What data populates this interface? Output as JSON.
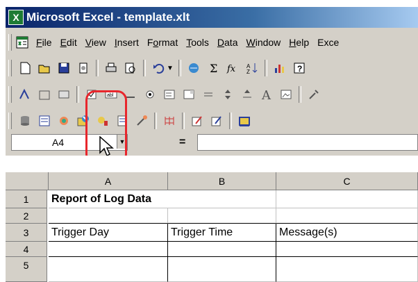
{
  "window": {
    "title": "Microsoft Excel - template.xlt",
    "app_icon_letter": "X"
  },
  "menu": {
    "items": [
      {
        "label": "File",
        "key": "F"
      },
      {
        "label": "Edit",
        "key": "E"
      },
      {
        "label": "View",
        "key": "V"
      },
      {
        "label": "Insert",
        "key": "I"
      },
      {
        "label": "Format",
        "key": "o"
      },
      {
        "label": "Tools",
        "key": "T"
      },
      {
        "label": "Data",
        "key": "D"
      },
      {
        "label": "Window",
        "key": "W"
      },
      {
        "label": "Help",
        "key": "H"
      },
      {
        "label": "Exce",
        "key": ""
      }
    ]
  },
  "formula": {
    "name_box": "A4",
    "equals": "="
  },
  "sheet": {
    "columns": [
      "A",
      "B",
      "C"
    ],
    "rows": [
      "1",
      "2",
      "3",
      "4",
      "5"
    ],
    "cells": {
      "A1": "Report of Log Data",
      "A3": "Trigger Day",
      "B3": "Trigger Time",
      "C3": "Message(s)"
    }
  },
  "colors": {
    "highlight": "#e8262c",
    "titlebar": "#0a246a"
  }
}
